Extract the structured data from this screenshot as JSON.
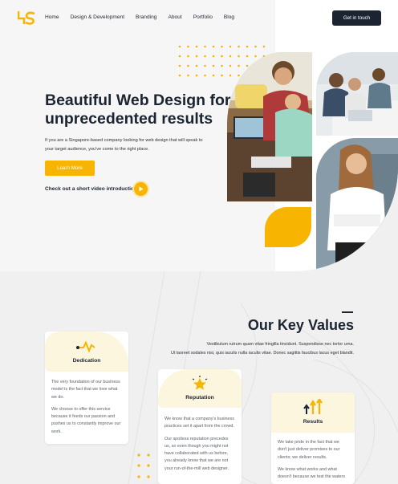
{
  "nav": {
    "logo_text": "4S",
    "links": [
      "Home",
      "Design & Development",
      "Branding",
      "About",
      "Portfolio",
      "Blog"
    ],
    "cta": "Get in touch"
  },
  "hero": {
    "title": "Beautiful Web Design for unprecedented results",
    "subtitle": "If you are a Singapore-based company looking for web design that will speak to your target audience, you've come to the right place.",
    "learn_more": "Learn More",
    "video_text": "Check out a short video introduction"
  },
  "values": {
    "title": "Our Key Values",
    "subtitle_1": "Vestibulum rutrum quam vitae fringilla tincidunt. Suspendisse nec tortor urna.",
    "subtitle_2": "Ut laoreet sodales nisi, quis iaculis nulla iaculis vitae. Donec sagittis faucibus lacus eget blandit.",
    "cards": [
      {
        "label": "Dedication",
        "icon": "pulse-icon",
        "text_1": "The very foundation of our business model is the fact that we love what we do.",
        "text_2": "We choose to offer this service because it feeds our passion and pushes us to constantly improve our work."
      },
      {
        "label": "Reputation",
        "icon": "star-icon",
        "text_1": "We know that a company's business practices set it apart from the crowd.",
        "text_2": "Our spotless reputation precedes us, so even though you might not have collaborated with us before, you already know that we are not your run-of-the-mill web designer."
      },
      {
        "label": "Results",
        "icon": "arrows-up-icon",
        "text_1": "We take pride in the fact that we don't just deliver promises to our clients; we deliver results.",
        "text_2": "We know what works and what doesn't because we test the waters"
      }
    ]
  },
  "colors": {
    "accent": "#f7b400",
    "dark": "#1c2431",
    "hero_bg": "#f6f6f6",
    "page_bg": "#f0f0f0"
  }
}
